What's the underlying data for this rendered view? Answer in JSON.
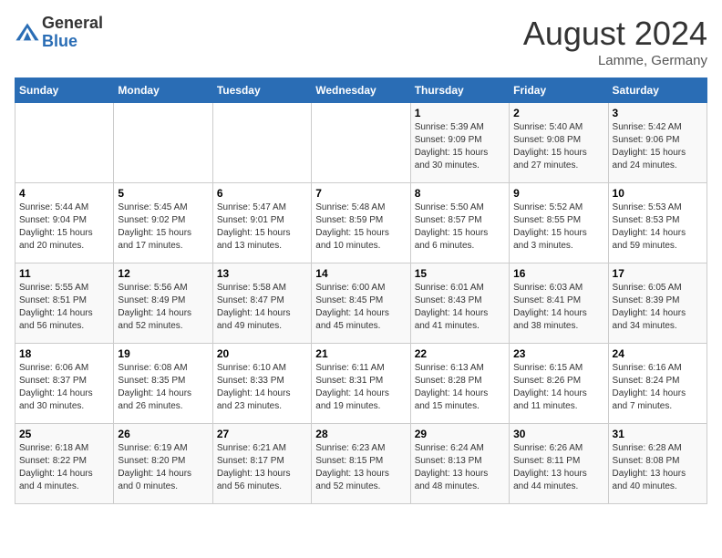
{
  "header": {
    "logo_line1": "General",
    "logo_line2": "Blue",
    "month": "August 2024",
    "location": "Lamme, Germany"
  },
  "days_of_week": [
    "Sunday",
    "Monday",
    "Tuesday",
    "Wednesday",
    "Thursday",
    "Friday",
    "Saturday"
  ],
  "weeks": [
    [
      {
        "num": "",
        "info": ""
      },
      {
        "num": "",
        "info": ""
      },
      {
        "num": "",
        "info": ""
      },
      {
        "num": "",
        "info": ""
      },
      {
        "num": "1",
        "info": "Sunrise: 5:39 AM\nSunset: 9:09 PM\nDaylight: 15 hours and 30 minutes."
      },
      {
        "num": "2",
        "info": "Sunrise: 5:40 AM\nSunset: 9:08 PM\nDaylight: 15 hours and 27 minutes."
      },
      {
        "num": "3",
        "info": "Sunrise: 5:42 AM\nSunset: 9:06 PM\nDaylight: 15 hours and 24 minutes."
      }
    ],
    [
      {
        "num": "4",
        "info": "Sunrise: 5:44 AM\nSunset: 9:04 PM\nDaylight: 15 hours and 20 minutes."
      },
      {
        "num": "5",
        "info": "Sunrise: 5:45 AM\nSunset: 9:02 PM\nDaylight: 15 hours and 17 minutes."
      },
      {
        "num": "6",
        "info": "Sunrise: 5:47 AM\nSunset: 9:01 PM\nDaylight: 15 hours and 13 minutes."
      },
      {
        "num": "7",
        "info": "Sunrise: 5:48 AM\nSunset: 8:59 PM\nDaylight: 15 hours and 10 minutes."
      },
      {
        "num": "8",
        "info": "Sunrise: 5:50 AM\nSunset: 8:57 PM\nDaylight: 15 hours and 6 minutes."
      },
      {
        "num": "9",
        "info": "Sunrise: 5:52 AM\nSunset: 8:55 PM\nDaylight: 15 hours and 3 minutes."
      },
      {
        "num": "10",
        "info": "Sunrise: 5:53 AM\nSunset: 8:53 PM\nDaylight: 14 hours and 59 minutes."
      }
    ],
    [
      {
        "num": "11",
        "info": "Sunrise: 5:55 AM\nSunset: 8:51 PM\nDaylight: 14 hours and 56 minutes."
      },
      {
        "num": "12",
        "info": "Sunrise: 5:56 AM\nSunset: 8:49 PM\nDaylight: 14 hours and 52 minutes."
      },
      {
        "num": "13",
        "info": "Sunrise: 5:58 AM\nSunset: 8:47 PM\nDaylight: 14 hours and 49 minutes."
      },
      {
        "num": "14",
        "info": "Sunrise: 6:00 AM\nSunset: 8:45 PM\nDaylight: 14 hours and 45 minutes."
      },
      {
        "num": "15",
        "info": "Sunrise: 6:01 AM\nSunset: 8:43 PM\nDaylight: 14 hours and 41 minutes."
      },
      {
        "num": "16",
        "info": "Sunrise: 6:03 AM\nSunset: 8:41 PM\nDaylight: 14 hours and 38 minutes."
      },
      {
        "num": "17",
        "info": "Sunrise: 6:05 AM\nSunset: 8:39 PM\nDaylight: 14 hours and 34 minutes."
      }
    ],
    [
      {
        "num": "18",
        "info": "Sunrise: 6:06 AM\nSunset: 8:37 PM\nDaylight: 14 hours and 30 minutes."
      },
      {
        "num": "19",
        "info": "Sunrise: 6:08 AM\nSunset: 8:35 PM\nDaylight: 14 hours and 26 minutes."
      },
      {
        "num": "20",
        "info": "Sunrise: 6:10 AM\nSunset: 8:33 PM\nDaylight: 14 hours and 23 minutes."
      },
      {
        "num": "21",
        "info": "Sunrise: 6:11 AM\nSunset: 8:31 PM\nDaylight: 14 hours and 19 minutes."
      },
      {
        "num": "22",
        "info": "Sunrise: 6:13 AM\nSunset: 8:28 PM\nDaylight: 14 hours and 15 minutes."
      },
      {
        "num": "23",
        "info": "Sunrise: 6:15 AM\nSunset: 8:26 PM\nDaylight: 14 hours and 11 minutes."
      },
      {
        "num": "24",
        "info": "Sunrise: 6:16 AM\nSunset: 8:24 PM\nDaylight: 14 hours and 7 minutes."
      }
    ],
    [
      {
        "num": "25",
        "info": "Sunrise: 6:18 AM\nSunset: 8:22 PM\nDaylight: 14 hours and 4 minutes."
      },
      {
        "num": "26",
        "info": "Sunrise: 6:19 AM\nSunset: 8:20 PM\nDaylight: 14 hours and 0 minutes."
      },
      {
        "num": "27",
        "info": "Sunrise: 6:21 AM\nSunset: 8:17 PM\nDaylight: 13 hours and 56 minutes."
      },
      {
        "num": "28",
        "info": "Sunrise: 6:23 AM\nSunset: 8:15 PM\nDaylight: 13 hours and 52 minutes."
      },
      {
        "num": "29",
        "info": "Sunrise: 6:24 AM\nSunset: 8:13 PM\nDaylight: 13 hours and 48 minutes."
      },
      {
        "num": "30",
        "info": "Sunrise: 6:26 AM\nSunset: 8:11 PM\nDaylight: 13 hours and 44 minutes."
      },
      {
        "num": "31",
        "info": "Sunrise: 6:28 AM\nSunset: 8:08 PM\nDaylight: 13 hours and 40 minutes."
      }
    ]
  ]
}
